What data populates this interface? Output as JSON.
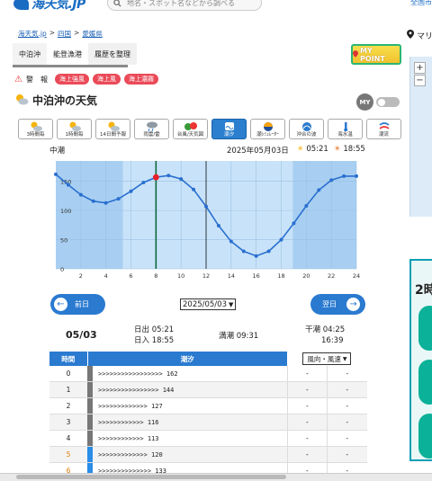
{
  "header": {
    "logo_text": "海天気.JP",
    "search_placeholder": "地名・スポット名などから調べる",
    "right_link": "全国市"
  },
  "breadcrumb": [
    "海天気.jp",
    "四国",
    "愛媛県"
  ],
  "right": {
    "pin_text": "マリ",
    "zoom_in": "+",
    "zoom_out": "−",
    "banner_text": "2時"
  },
  "tabs": [
    {
      "label": "中泊沖",
      "state": "active"
    },
    {
      "label": "能登漁港",
      "state": "normal"
    },
    {
      "label": "履歴を整理",
      "state": "highlight"
    }
  ],
  "mypoint": "MY POINT",
  "warnings": {
    "label": "警　報",
    "badges": [
      "海上強風",
      "海上風",
      "海上濃霧"
    ]
  },
  "page_title": "中泊沖の天気",
  "my_label": "MY",
  "icon_buttons": [
    {
      "label": "3時間毎",
      "icon": "sun-cloud-icon"
    },
    {
      "label": "1時間毎",
      "icon": "sun-cloud-icon"
    },
    {
      "label": "14日間予報",
      "icon": "sun-cloud-icon"
    },
    {
      "label": "雨雲/雷",
      "icon": "rain-cloud-icon"
    },
    {
      "label": "台風/天気図",
      "icon": "typhoon-icon"
    },
    {
      "label": "潮汐",
      "icon": "tide-icon",
      "active": true
    },
    {
      "label": "潮ｼﾐｭﾚｰﾀｰ",
      "icon": "tide-sim-icon"
    },
    {
      "label": "沖合の波",
      "icon": "wave-icon"
    },
    {
      "label": "海水温",
      "icon": "thermometer-icon"
    },
    {
      "label": "潮流",
      "icon": "current-icon"
    }
  ],
  "chart_info": {
    "tide_name": "中潮",
    "date": "2025年05月03日",
    "sunrise": "05:21",
    "sunset": "18:55"
  },
  "chart_data": {
    "type": "line",
    "x": [
      0,
      1,
      2,
      3,
      4,
      5,
      6,
      7,
      8,
      9,
      10,
      11,
      12,
      13,
      14,
      15,
      16,
      17,
      18,
      19,
      20,
      21,
      22,
      23,
      24
    ],
    "series": [
      {
        "values": [
          162,
          144,
          127,
          116,
          113,
          120,
          133,
          148,
          157,
          160,
          154,
          136,
          107,
          74,
          47,
          30,
          22,
          30,
          50,
          78,
          108,
          135,
          152,
          159,
          159
        ]
      }
    ],
    "xticks": [
      2,
      4,
      6,
      8,
      10,
      12,
      14,
      16,
      18,
      20,
      22,
      24
    ],
    "yticks": [
      0,
      50,
      100,
      150
    ],
    "xlim": [
      0,
      24
    ],
    "ylim": [
      0,
      185
    ],
    "daylight": [
      5.35,
      18.92
    ],
    "high_marker_x": 8,
    "current_time_x": 12,
    "grid": true
  },
  "nav": {
    "prev_label": "前日",
    "next_label": "翌日",
    "date_select": "2025/05/03"
  },
  "summary": {
    "date": "05/03",
    "sunrise": "日出 05:21",
    "sunset": "日入 18:55",
    "high_tide": "満潮 09:31",
    "low_tide_1": "干潮 04:25",
    "low_tide_2": "16:39"
  },
  "table": {
    "headers": {
      "time": "時間",
      "tide": "潮汐",
      "wind": "風向・風速"
    },
    "rows": [
      {
        "hour": "0",
        "tide": ">>>>>>>>>>>>>>>>> 162",
        "w1": "-",
        "w2": "-",
        "bar": "#777777",
        "orange": false
      },
      {
        "hour": "1",
        "tide": ">>>>>>>>>>>>>>>> 144",
        "w1": "-",
        "w2": "-",
        "bar": "#777777",
        "orange": false
      },
      {
        "hour": "2",
        "tide": ">>>>>>>>>>>>> 127",
        "w1": "-",
        "w2": "-",
        "bar": "#777777",
        "orange": false
      },
      {
        "hour": "3",
        "tide": ">>>>>>>>>>>> 116",
        "w1": "-",
        "w2": "-",
        "bar": "#777777",
        "orange": false
      },
      {
        "hour": "4",
        "tide": ">>>>>>>>>>>> 113",
        "w1": "-",
        "w2": "-",
        "bar": "#777777",
        "orange": false
      },
      {
        "hour": "5",
        "tide": ">>>>>>>>>>>>> 120",
        "w1": "-",
        "w2": "-",
        "bar": "#2a8de8",
        "orange": true
      },
      {
        "hour": "6",
        "tide": ">>>>>>>>>>>>>> 133",
        "w1": "-",
        "w2": "-",
        "bar": "#2a8de8",
        "orange": true
      }
    ]
  },
  "colors": {
    "accent": "#2a7ad0",
    "night": "#a8cff2",
    "day": "#c8e3f9",
    "line": "#2a6fd0",
    "marker": "#e8202a",
    "now_line": "#0e6b3d"
  }
}
